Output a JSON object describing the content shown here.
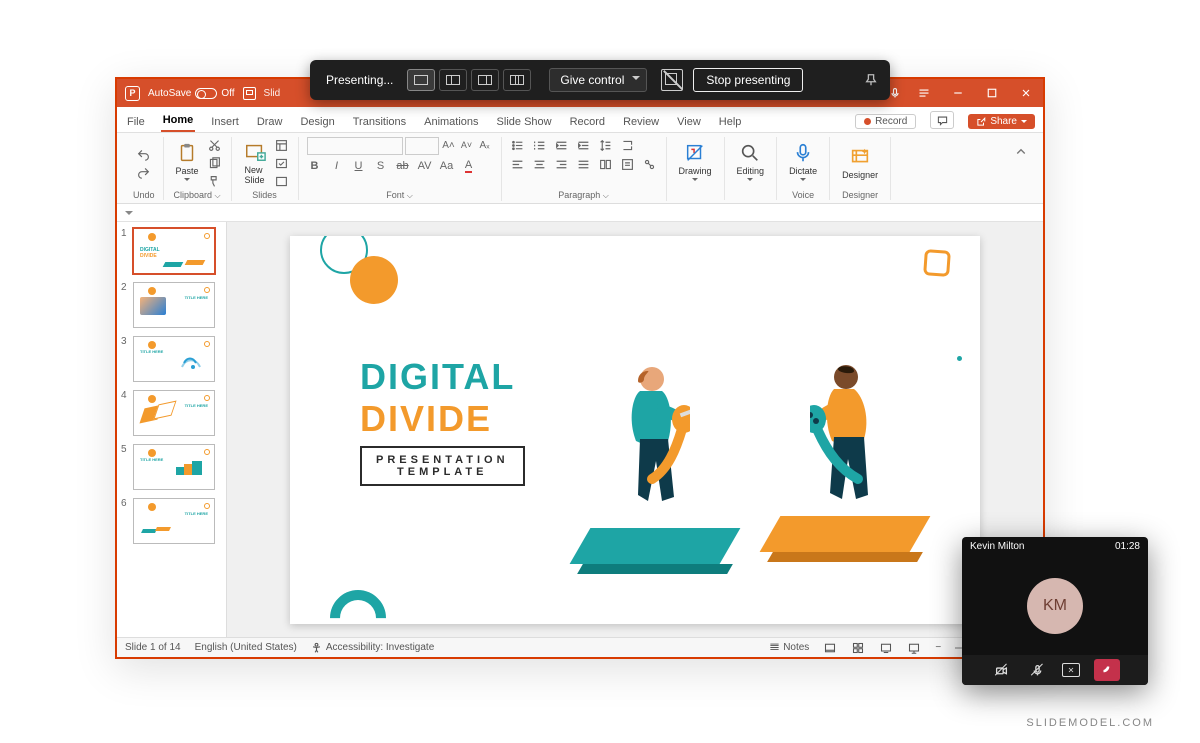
{
  "presenting_bar": {
    "label": "Presenting...",
    "give_control": "Give control",
    "stop": "Stop presenting"
  },
  "titlebar": {
    "autosave_label": "AutoSave",
    "autosave_state": "Off",
    "doc_title": "Slid"
  },
  "tabs": [
    "File",
    "Home",
    "Insert",
    "Draw",
    "Design",
    "Transitions",
    "Animations",
    "Slide Show",
    "Record",
    "Review",
    "View",
    "Help"
  ],
  "active_tab": "Home",
  "record_btn": "Record",
  "share_btn": "Share",
  "ribbon": {
    "undo": "Undo",
    "clipboard": {
      "paste": "Paste",
      "label": "Clipboard"
    },
    "slides": {
      "new_slide": "New\nSlide",
      "label": "Slides"
    },
    "font": {
      "label": "Font",
      "btns": [
        "B",
        "I",
        "U",
        "S",
        "ab",
        "AV",
        "Aa",
        "A"
      ]
    },
    "paragraph": {
      "label": "Paragraph"
    },
    "drawing": {
      "btn": "Drawing",
      "label": ""
    },
    "editing": {
      "btn": "Editing",
      "label": ""
    },
    "voice": {
      "btn": "Dictate",
      "label": "Voice"
    },
    "designer": {
      "btn": "Designer",
      "label": "Designer"
    }
  },
  "thumbnails": [
    1,
    2,
    3,
    4,
    5,
    6
  ],
  "thumb_titles": [
    "DIGITAL",
    "TITLE HERE",
    "TITLE HERE",
    "TITLE HERE",
    "TITLE HERE",
    "TITLE HERE"
  ],
  "slide": {
    "line1": "DIGITAL",
    "line2": "DIVIDE",
    "sub1": "PRESENTATION",
    "sub2": "TEMPLATE"
  },
  "status": {
    "slide": "Slide 1 of 14",
    "lang": "English (United States)",
    "access": "Accessibility: Investigate",
    "notes": "Notes"
  },
  "call": {
    "name": "Kevin Milton",
    "time": "01:28",
    "initials": "KM"
  },
  "watermark": "SLIDEMODEL.COM"
}
